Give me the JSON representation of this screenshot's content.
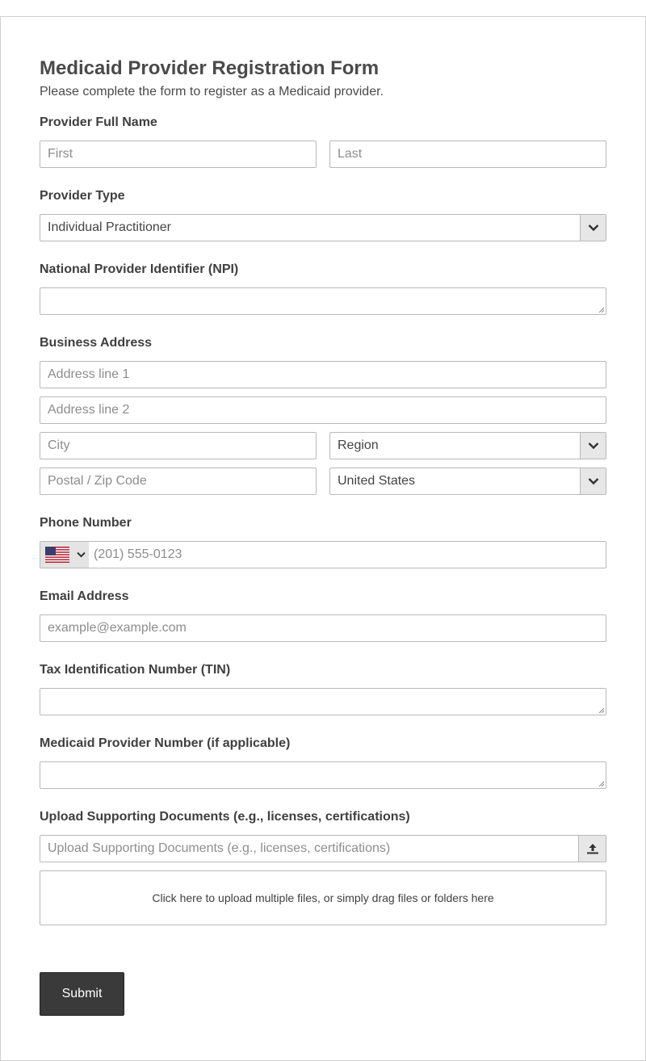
{
  "form": {
    "title": "Medicaid Provider Registration Form",
    "subtitle": "Please complete the form to register as a Medicaid provider."
  },
  "provider_name": {
    "label": "Provider Full Name",
    "first_placeholder": "First",
    "last_placeholder": "Last"
  },
  "provider_type": {
    "label": "Provider Type",
    "selected": "Individual Practitioner"
  },
  "npi": {
    "label": "National Provider Identifier (NPI)",
    "value": ""
  },
  "address": {
    "label": "Business Address",
    "line1_placeholder": "Address line 1",
    "line2_placeholder": "Address line 2",
    "city_placeholder": "City",
    "region_selected": "Region",
    "postal_placeholder": "Postal / Zip Code",
    "country_selected": "United States"
  },
  "phone": {
    "label": "Phone Number",
    "placeholder": "(201) 555-0123",
    "country_flag_icon": "us-flag-icon"
  },
  "email": {
    "label": "Email Address",
    "placeholder": "example@example.com"
  },
  "tin": {
    "label": "Tax Identification Number (TIN)",
    "value": ""
  },
  "medicaid_number": {
    "label": "Medicaid Provider Number (if applicable)",
    "value": ""
  },
  "upload": {
    "label": "Upload Supporting Documents (e.g., licenses, certifications)",
    "placeholder": "Upload Supporting Documents (e.g., licenses, certifications)",
    "dropzone_text": "Click here to upload multiple files, or simply drag files or folders here",
    "icon": "upload-icon"
  },
  "submit": {
    "label": "Submit"
  },
  "colors": {
    "button_bg": "#3a3a3a",
    "border": "#b9b9b9",
    "select_button_bg": "#e7e7e7"
  }
}
